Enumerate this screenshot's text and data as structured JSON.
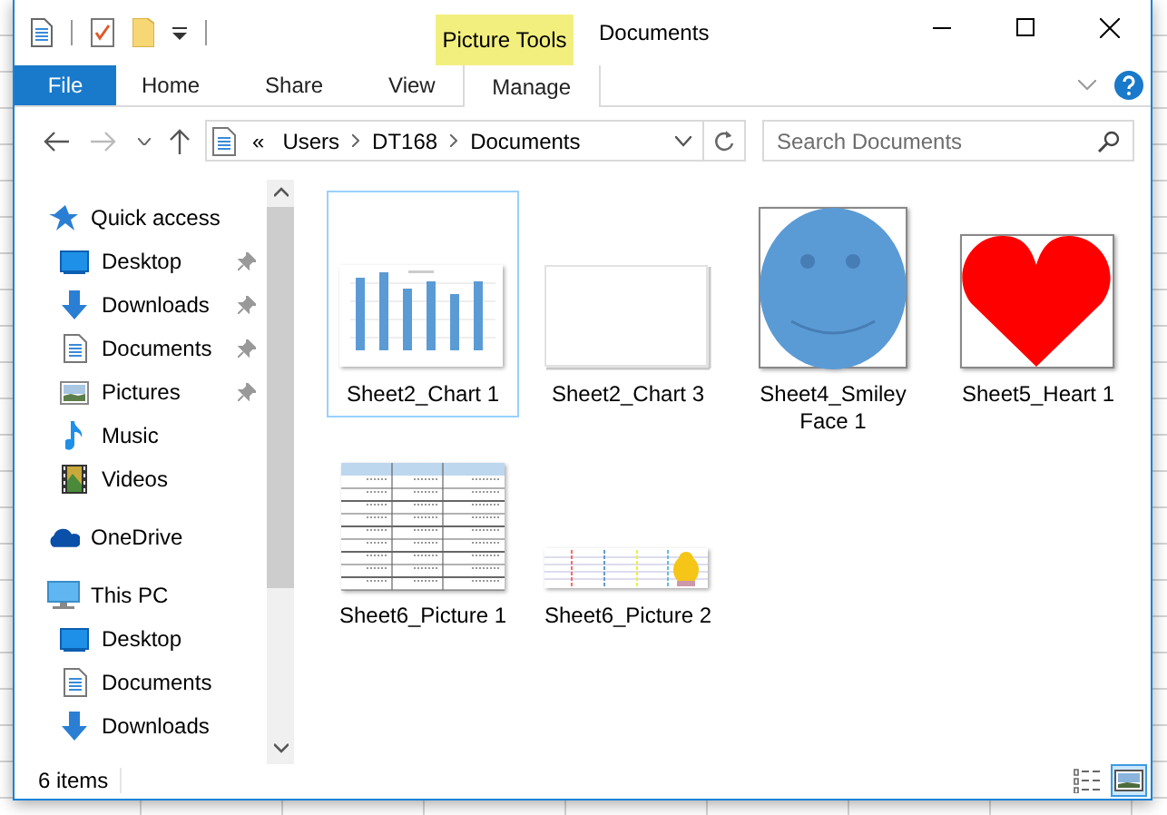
{
  "window": {
    "title": "Documents"
  },
  "context_tab_group": "Picture Tools",
  "ribbon_tabs": [
    {
      "label": "File",
      "kind": "file"
    },
    {
      "label": "Home",
      "kind": "plain"
    },
    {
      "label": "Share",
      "kind": "plain"
    },
    {
      "label": "View",
      "kind": "plain"
    },
    {
      "label": "Manage",
      "kind": "contextual"
    }
  ],
  "address": {
    "overflow": "«",
    "crumbs": [
      "Users",
      "DT168",
      "Documents"
    ]
  },
  "search": {
    "placeholder": "Search Documents"
  },
  "nav": [
    {
      "label": "Quick access",
      "kind": "quick",
      "children": [
        {
          "label": "Desktop",
          "kind": "desktop",
          "pinned": true
        },
        {
          "label": "Downloads",
          "kind": "downloads",
          "pinned": true
        },
        {
          "label": "Documents",
          "kind": "documents",
          "pinned": true
        },
        {
          "label": "Pictures",
          "kind": "pictures",
          "pinned": true
        },
        {
          "label": "Music",
          "kind": "music",
          "pinned": false
        },
        {
          "label": "Videos",
          "kind": "videos",
          "pinned": false
        }
      ]
    },
    {
      "label": "OneDrive",
      "kind": "onedrive"
    },
    {
      "label": "This PC",
      "kind": "pc",
      "children": [
        {
          "label": "Desktop",
          "kind": "desktop",
          "pinned": false
        },
        {
          "label": "Documents",
          "kind": "documents",
          "pinned": false
        },
        {
          "label": "Downloads",
          "kind": "downloads",
          "pinned": false
        }
      ]
    }
  ],
  "files": [
    {
      "name": "Sheet2_Chart 1",
      "kind": "chart",
      "selected": true
    },
    {
      "name": "Sheet2_Chart 3",
      "kind": "blank",
      "selected": false
    },
    {
      "name": "Sheet4_Smiley Face 1",
      "kind": "smiley",
      "selected": false
    },
    {
      "name": "Sheet5_Heart 1",
      "kind": "heart",
      "selected": false
    },
    {
      "name": "Sheet6_Picture 1",
      "kind": "table",
      "selected": false
    },
    {
      "name": "Sheet6_Picture 2",
      "kind": "strip",
      "selected": false
    }
  ],
  "status_bar": {
    "count": "6 items"
  },
  "view_buttons": [
    {
      "kind": "details",
      "selected": false
    },
    {
      "kind": "thumbnails",
      "selected": true
    }
  ]
}
